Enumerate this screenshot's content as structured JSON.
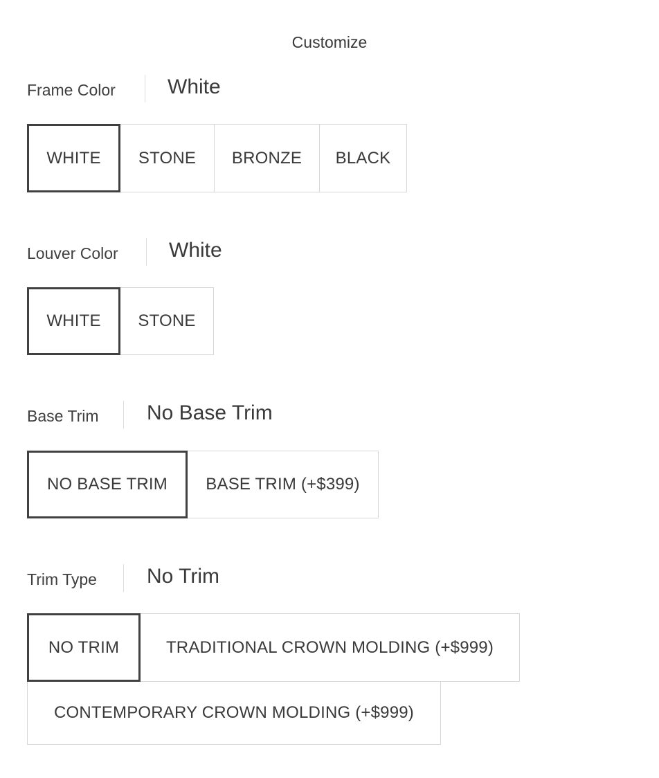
{
  "page": {
    "title": "Customize"
  },
  "sections": [
    {
      "label": "Frame Color",
      "selected_value": "White",
      "options": [
        {
          "label": "WHITE",
          "selected": true
        },
        {
          "label": "STONE",
          "selected": false
        },
        {
          "label": "BRONZE",
          "selected": false
        },
        {
          "label": "BLACK",
          "selected": false
        }
      ]
    },
    {
      "label": "Louver Color",
      "selected_value": "White",
      "options": [
        {
          "label": "WHITE",
          "selected": true
        },
        {
          "label": "STONE",
          "selected": false
        }
      ]
    },
    {
      "label": "Base Trim",
      "selected_value": "No Base Trim",
      "options": [
        {
          "label": "NO BASE TRIM",
          "selected": true
        },
        {
          "label": "BASE TRIM (+$399)",
          "selected": false
        }
      ]
    },
    {
      "label": "Trim Type",
      "selected_value": "No Trim",
      "options": [
        {
          "label": "NO TRIM",
          "selected": true
        },
        {
          "label": "TRADITIONAL CROWN MOLDING (+$999)",
          "selected": false
        },
        {
          "label": "CONTEMPORARY CROWN MOLDING (+$999)",
          "selected": false
        }
      ]
    }
  ]
}
